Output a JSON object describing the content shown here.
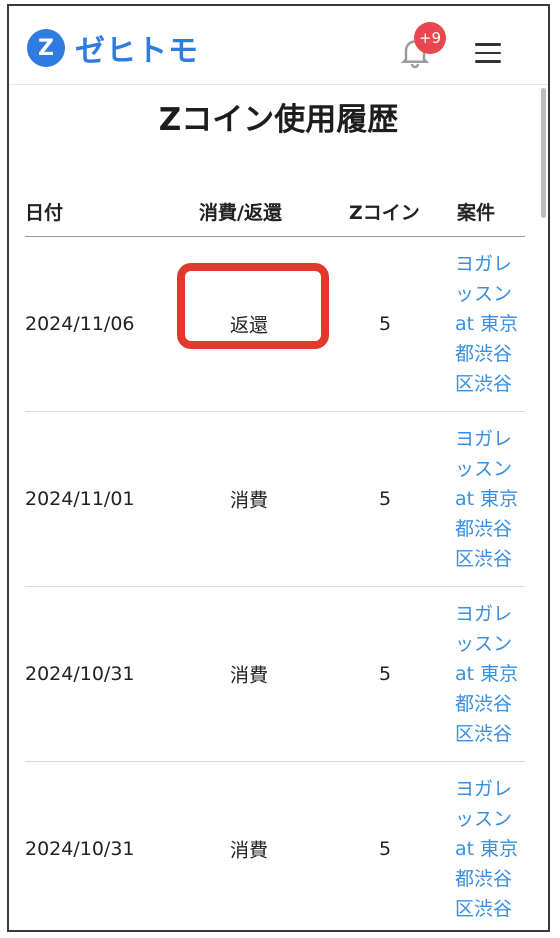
{
  "header": {
    "logo_mark": "Z",
    "logo_text": "ゼヒトモ",
    "notification_badge": "+9",
    "icons": [
      "bell-icon",
      "hamburger-menu-icon"
    ]
  },
  "page": {
    "title": "Zコイン使用履歴"
  },
  "table": {
    "headers": {
      "date": "日付",
      "type": "消費/返還",
      "coins": "Zコイン",
      "case": "案件"
    },
    "rows": [
      {
        "date": "2024/11/06",
        "type": "返還",
        "coins": "5",
        "case_lines": [
          "ヨガレ",
          "ッスン",
          "at 東京",
          "都渋谷",
          "区渋谷"
        ]
      },
      {
        "date": "2024/11/01",
        "type": "消費",
        "coins": "5",
        "case_lines": [
          "ヨガレ",
          "ッスン",
          "at 東京",
          "都渋谷",
          "区渋谷"
        ]
      },
      {
        "date": "2024/10/31",
        "type": "消費",
        "coins": "5",
        "case_lines": [
          "ヨガレ",
          "ッスン",
          "at 東京",
          "都渋谷",
          "区渋谷"
        ]
      },
      {
        "date": "2024/10/31",
        "type": "消費",
        "coins": "5",
        "case_lines": [
          "ヨガレ",
          "ッスン",
          "at 東京",
          "都渋谷",
          "区渋谷"
        ]
      }
    ]
  },
  "colors": {
    "brand": "#2f7be0",
    "link": "#3a8fe0",
    "badge": "#e8474f",
    "highlight": "#e23a2a"
  }
}
